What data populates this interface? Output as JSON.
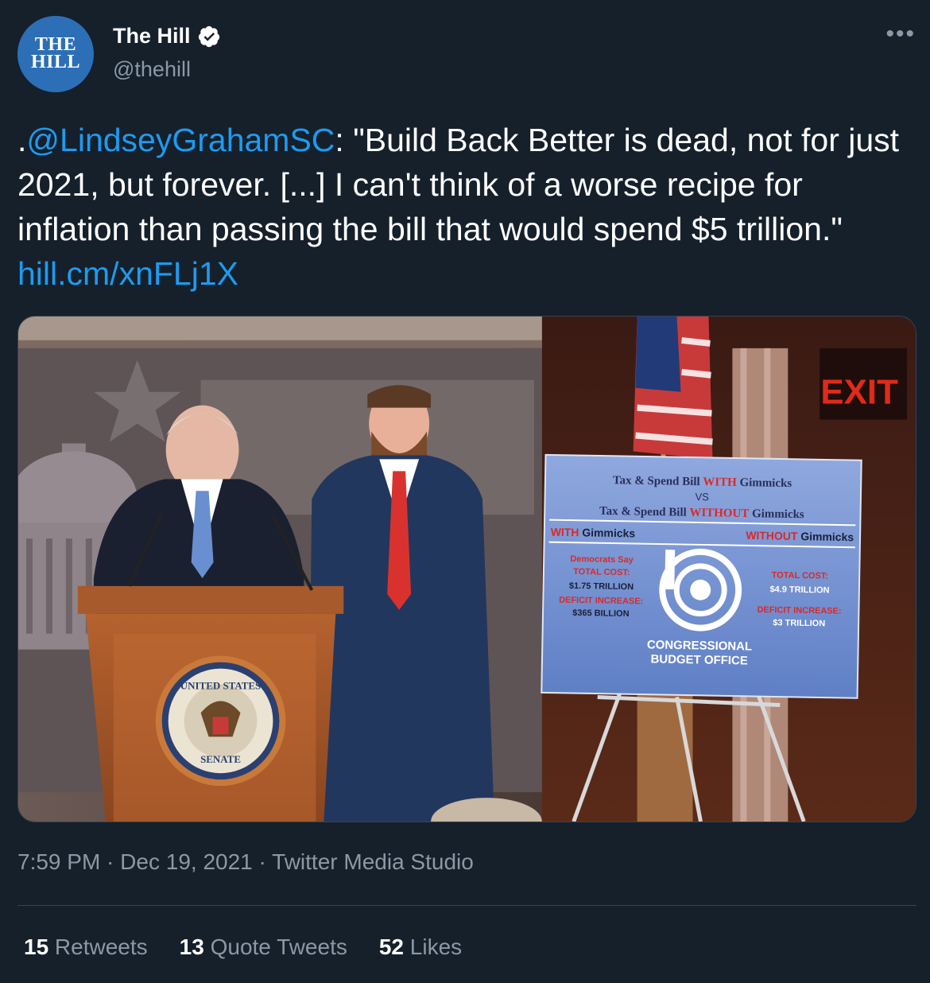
{
  "account": {
    "avatar_line1": "THE",
    "avatar_line2": "HILL",
    "display_name": "The Hill",
    "handle": "@thehill",
    "verified": true
  },
  "more_icon": "more-horizontal-icon",
  "tweet": {
    "text_prefix": ".",
    "mention": "@LindseyGrahamSC",
    "text_body": ": \"Build Back Better is dead, not for just 2021, but forever. [...] I can't think of a worse recipe for inflation than passing the bill that would spend $5 trillion.\" ",
    "link": "hill.cm/xnFLj1X"
  },
  "media": {
    "exit_sign": "EXIT",
    "poster": {
      "line1a": "Tax & Spend Bill ",
      "line1b": "WITH",
      "line1c": " Gimmicks",
      "vs": "VS",
      "line2a": "Tax & Spend Bill ",
      "line2b": "WITHOUT",
      "line2c": " Gimmicks",
      "col_left_a": "WITH",
      "col_left_b": " Gimmicks",
      "col_right_a": "WITHOUT",
      "col_right_b": " Gimmicks",
      "left_1": "Democrats Say",
      "left_2": "TOTAL COST:",
      "left_3": "$1.75 TRILLION",
      "left_4": "DEFICIT INCREASE:",
      "left_5": "$365 BILLION",
      "right_1": "TOTAL COST:",
      "right_2": "$4.9 TRILLION",
      "right_3": "DEFICIT INCREASE:",
      "right_4": "$3 TRILLION",
      "cbo_1": "CONGRESSIONAL",
      "cbo_2": "BUDGET OFFICE"
    },
    "seal_top": "UNITED STATES",
    "seal_bottom": "SENATE"
  },
  "meta": {
    "time": "7:59 PM",
    "sep1": " · ",
    "date": "Dec 19, 2021",
    "sep2": " · ",
    "source": "Twitter Media Studio"
  },
  "stats": {
    "retweets_count": "15",
    "retweets_label": " Retweets",
    "quotes_count": "13",
    "quotes_label": " Quote Tweets",
    "likes_count": "52",
    "likes_label": " Likes"
  },
  "colors": {
    "background": "#15202b",
    "link": "#1d9bf0",
    "secondary_text": "#8b98a5",
    "divider": "#38444d"
  }
}
